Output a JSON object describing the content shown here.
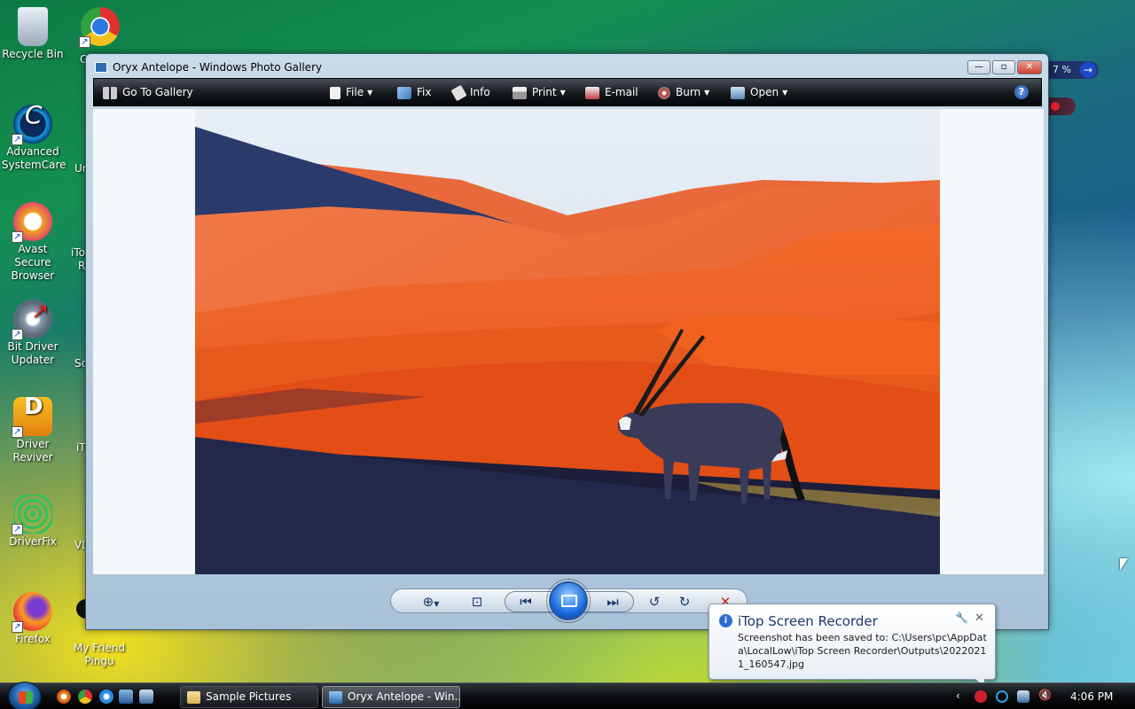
{
  "desktop": {
    "icons": [
      {
        "label": "Recycle Bin",
        "icon": "recycle-bin-icon"
      },
      {
        "label": "Advanced SystemCare",
        "icon": "advanced-systemcare-icon"
      },
      {
        "label": "Avast Secure Browser",
        "icon": "avast-browser-icon"
      },
      {
        "label": "Bit Driver Updater",
        "icon": "bit-driver-updater-icon"
      },
      {
        "label": "Driver Reviver",
        "icon": "driver-reviver-icon"
      },
      {
        "label": "DriverFix",
        "icon": "driverfix-icon"
      },
      {
        "label": "Firefox",
        "icon": "firefox-icon"
      }
    ],
    "partial_labels": [
      "C",
      "C",
      "Ur",
      "iTo",
      "R",
      "Sc",
      "iT",
      "VL"
    ],
    "extra_icons": [
      {
        "label": "My Friend Pingu",
        "icon": "pingu-icon"
      }
    ],
    "chrome_icon": "chrome-icon"
  },
  "window": {
    "title": "Oryx Antelope - Windows Photo Gallery",
    "toolbar": {
      "go_to_gallery": "Go To Gallery",
      "file": "File",
      "fix": "Fix",
      "info": "Info",
      "print": "Print",
      "email": "E-mail",
      "burn": "Burn",
      "open": "Open",
      "help": "?"
    }
  },
  "notification": {
    "title": "iTop Screen Recorder",
    "body": "Screenshot has been saved to: C:\\Users\\pc\\AppData\\LocalLow\\iTop Screen Recorder\\Outputs\\20220211_160547.jpg"
  },
  "gadget": {
    "value": "7 %"
  },
  "taskbar": {
    "tasks": [
      {
        "label": "Sample Pictures"
      },
      {
        "label": "Oryx Antelope - Win..."
      }
    ],
    "clock": "4:06 PM"
  },
  "colors": {
    "accent": "#1a6adc",
    "close": "#c8402a",
    "toolbar": "#15181c"
  }
}
